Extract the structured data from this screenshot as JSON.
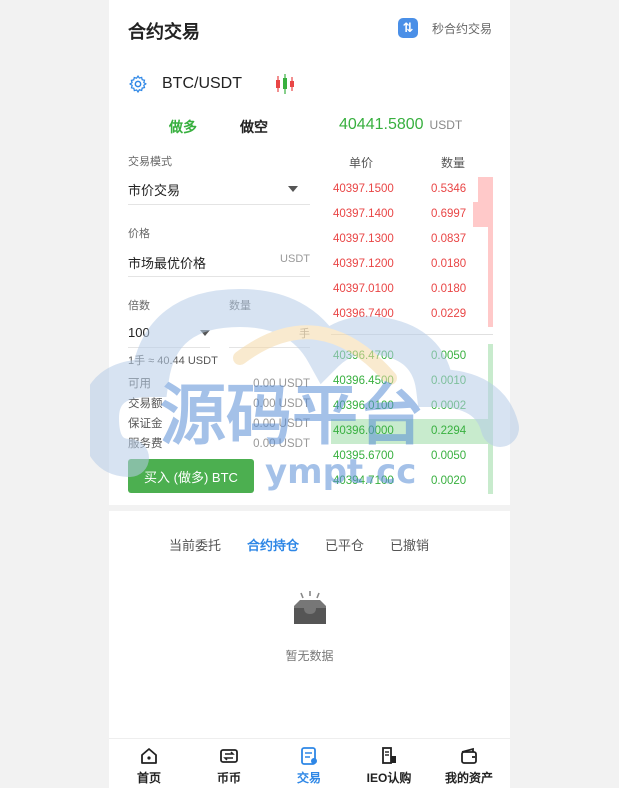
{
  "header": {
    "title": "合约交易",
    "second_link": "秒合约交易",
    "second_icon": "swap-icon"
  },
  "pair": {
    "name": "BTC/USDT",
    "settings_icon": "gear-icon",
    "chart_icon": "candlestick-icon"
  },
  "sides": {
    "long": "做多",
    "short": "做空"
  },
  "last_price": {
    "value": "40441.5800",
    "unit": "USDT"
  },
  "form": {
    "mode_label": "交易模式",
    "mode_value": "市价交易",
    "price_label": "价格",
    "price_value": "市场最优价格",
    "price_unit": "USDT",
    "leverage_label": "倍数",
    "leverage_value": "100",
    "qty_label": "数量",
    "qty_unit": "手",
    "conversion": "1手 ≈ 40.44 USDT",
    "info": [
      {
        "k": "可用",
        "v": "0.00 USDT"
      },
      {
        "k": "交易额",
        "v": "0.00 USDT"
      },
      {
        "k": "保证金",
        "v": "0.00 USDT"
      },
      {
        "k": "服务费",
        "v": "0.00 USDT"
      }
    ],
    "buy_button": "买入 (做多) BTC"
  },
  "orderbook": {
    "price_header": "单价",
    "qty_header": "数量",
    "asks": [
      {
        "price": "40397.1500",
        "qty": "0.5346",
        "depth": 0.28
      },
      {
        "price": "40397.1400",
        "qty": "0.6997",
        "depth": 0.38
      },
      {
        "price": "40397.1300",
        "qty": "0.0837",
        "depth": 0.1
      },
      {
        "price": "40397.1200",
        "qty": "0.0180",
        "depth": 0.1
      },
      {
        "price": "40397.0100",
        "qty": "0.0180",
        "depth": 0.1
      },
      {
        "price": "40396.7400",
        "qty": "0.0229",
        "depth": 0.1
      }
    ],
    "bids": [
      {
        "price": "40396.4700",
        "qty": "0.0050",
        "depth": 0.1
      },
      {
        "price": "40396.4500",
        "qty": "0.0010",
        "depth": 0.1
      },
      {
        "price": "40396.0100",
        "qty": "0.0002",
        "depth": 0.1
      },
      {
        "price": "40396.0000",
        "qty": "0.2294",
        "depth": 1.0
      },
      {
        "price": "40395.6700",
        "qty": "0.0050",
        "depth": 0.1
      },
      {
        "price": "40394.7100",
        "qty": "0.0020",
        "depth": 0.1
      }
    ]
  },
  "tabs": [
    "当前委托",
    "合约持仓",
    "已平仓",
    "已撤销"
  ],
  "active_tab": 1,
  "empty_text": "暂无数据",
  "nav": [
    {
      "label": "首页",
      "icon": "home-icon"
    },
    {
      "label": "币币",
      "icon": "exchange-icon"
    },
    {
      "label": "交易",
      "icon": "trade-icon"
    },
    {
      "label": "IEO认购",
      "icon": "ieo-icon"
    },
    {
      "label": "我的资产",
      "icon": "wallet-icon"
    }
  ],
  "active_nav": 2,
  "watermark": {
    "text": "源码平台",
    "url": "ympt.cc"
  },
  "colors": {
    "green": "#38b03f",
    "red": "#e94545",
    "blue": "#2e87e6",
    "button": "#4caf50"
  }
}
